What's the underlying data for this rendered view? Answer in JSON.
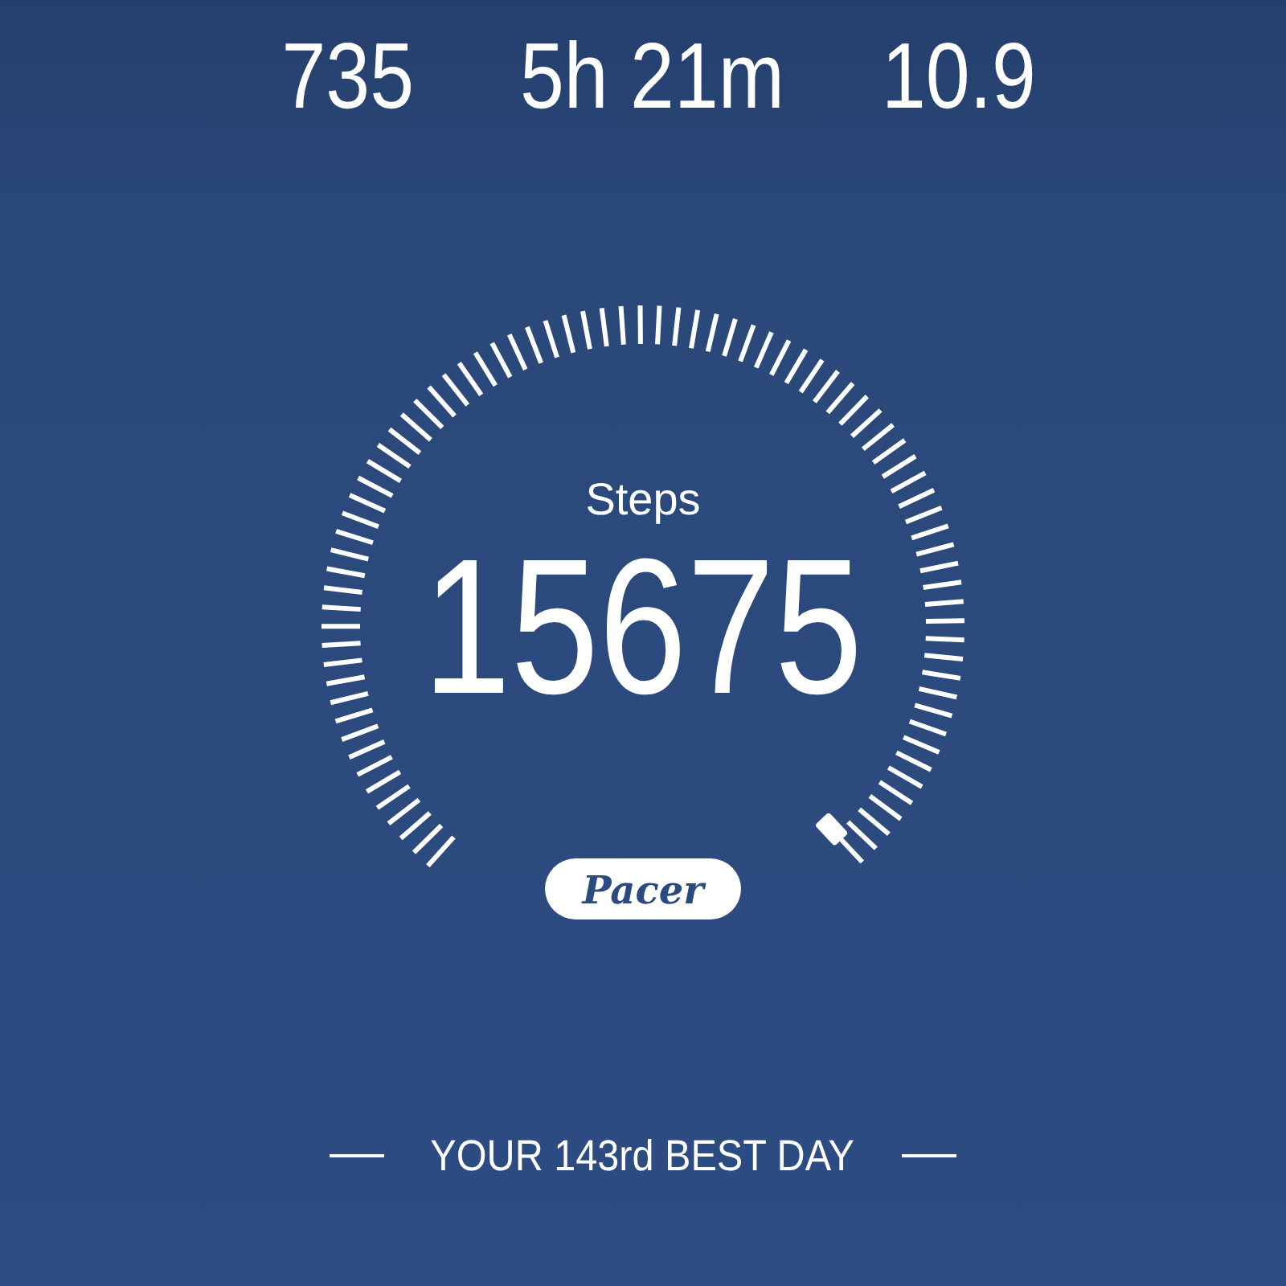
{
  "stats": [
    {
      "value": "735"
    },
    {
      "value": "5h 21m"
    },
    {
      "value": "10.9"
    }
  ],
  "gauge": {
    "label": "Steps",
    "value": "15675"
  },
  "badge": {
    "text": "Pacer"
  },
  "best_day": "YOUR 143rd BEST DAY"
}
